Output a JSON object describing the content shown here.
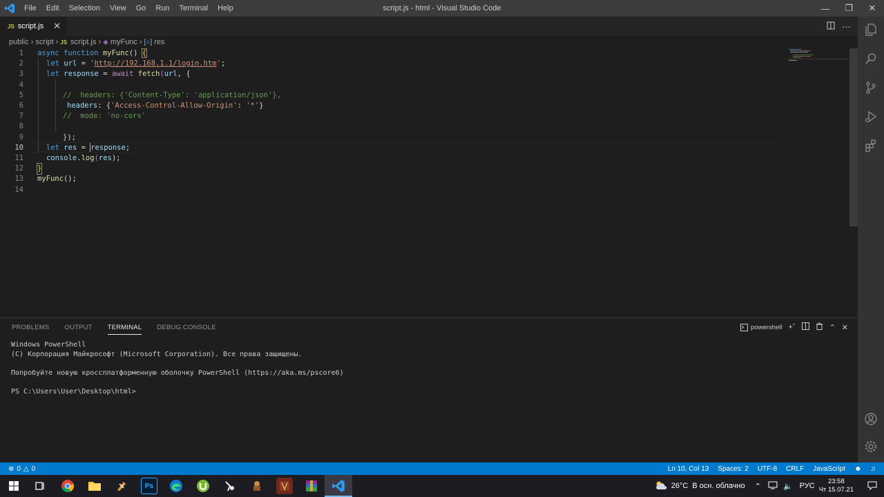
{
  "titlebar": {
    "menu": [
      "File",
      "Edit",
      "Selection",
      "View",
      "Go",
      "Run",
      "Terminal",
      "Help"
    ],
    "title": "script.js - html - Visual Studio Code"
  },
  "tab": {
    "badge": "JS",
    "label": "script.js"
  },
  "breadcrumb": {
    "items": [
      "public",
      "script",
      "script.js",
      "myFunc",
      "res"
    ],
    "js_badge": "JS"
  },
  "editor": {
    "line_numbers": [
      "1",
      "2",
      "3",
      "4",
      "5",
      "6",
      "7",
      "8",
      "9",
      "10",
      "11",
      "12",
      "13",
      "14"
    ],
    "active_line": "10",
    "code": {
      "l1": {
        "async": "async",
        "function": "function",
        "name": "myFunc",
        "parens": "()",
        "sp": " ",
        "brace": "{"
      },
      "l2": {
        "let": "let",
        "var": "url",
        "eq": " = ",
        "q1": "'",
        "url": "http://192.168.1.1/login.htm",
        "q2": "'",
        "semi": ";"
      },
      "l3": {
        "let": "let",
        "var": "response",
        "eq": " = ",
        "await": "await",
        "fetch": "fetch",
        "open": "(",
        "arg": "url",
        "rest": ", {"
      },
      "l5": "//  headers: {'Content-Type': 'application/json'},",
      "l6": {
        "prop": "headers",
        "colon": ": {",
        "str1": "'Access-Control-Allow-Origin'",
        "colon2": ": ",
        "str2": "'*'",
        "close": "}"
      },
      "l7": "//  mode: 'no-cors'",
      "l9": "});",
      "l10": {
        "let": "let",
        "var": "res",
        "eq": " = ",
        "val": "response",
        "semi": ";"
      },
      "l11": {
        "obj": "console",
        "dot": ".",
        "fn": "log",
        "open": "(",
        "arg": "res",
        "close": ");"
      },
      "l12": "}",
      "l13": {
        "fn": "myFunc",
        "rest": "();"
      }
    }
  },
  "panel": {
    "tabs": [
      "PROBLEMS",
      "OUTPUT",
      "TERMINAL",
      "DEBUG CONSOLE"
    ],
    "shell": "powershell",
    "terminal_lines": [
      "Windows PowerShell",
      "(C) Корпорация Майкрософт (Microsoft Corporation). Все права защищены.",
      "",
      "Попробуйте новую кроссплатформенную оболочку PowerShell (https://aka.ms/pscore6)",
      "",
      "PS C:\\Users\\User\\Desktop\\html>"
    ]
  },
  "statusbar": {
    "errors": "0",
    "warnings": "0",
    "position": "Ln 10, Col 13",
    "spaces": "Spaces: 2",
    "encoding": "UTF-8",
    "eol": "CRLF",
    "language": "JavaScript"
  },
  "taskbar": {
    "weather": "26°C  В осн. облачно",
    "lang": "РУС",
    "time": "23:58",
    "date": "Чт 15.07.21",
    "apps": [
      "task-view",
      "chrome",
      "file-explorer",
      "app",
      "photoshop",
      "edge",
      "utorrent",
      "app",
      "app",
      "app",
      "winrar",
      "vscode"
    ]
  },
  "colors": {
    "accent": "#007acc",
    "titlebar": "#3c3c3c",
    "editor_bg": "#1e1e1e",
    "activitybar": "#333333"
  }
}
